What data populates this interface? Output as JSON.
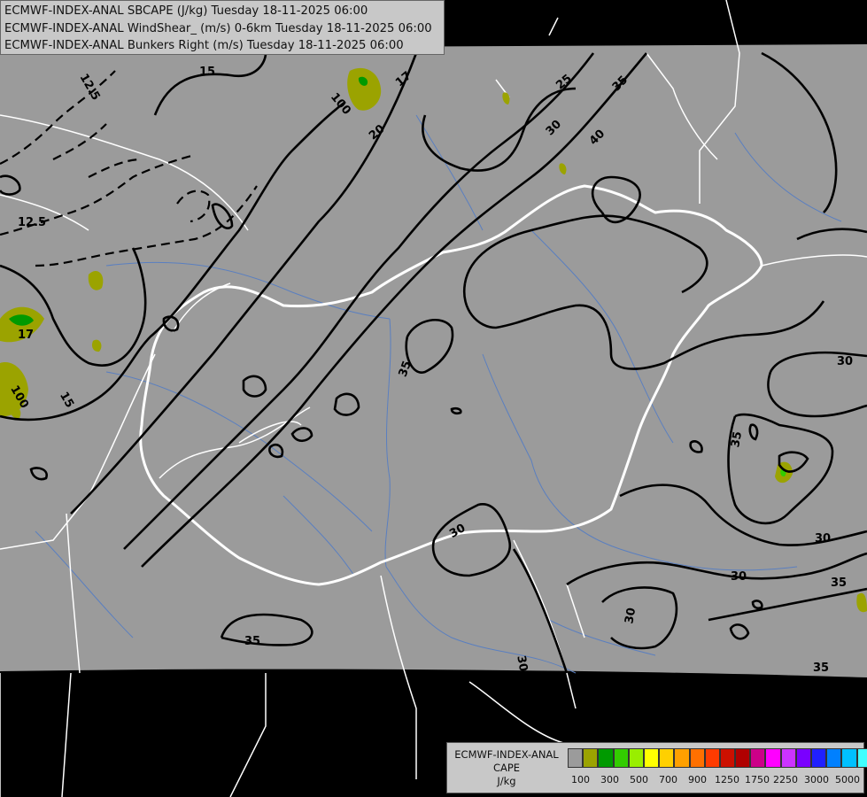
{
  "titles": [
    "ECMWF-INDEX-ANAL SBCAPE (J/kg) Tuesday 18-11-2025 06:00",
    "ECMWF-INDEX-ANAL WindShear_ (m/s) 0-6km Tuesday 18-11-2025 06:00",
    "ECMWF-INDEX-ANAL Bunkers Right (m/s) Tuesday 18-11-2025 06:00"
  ],
  "colors": {
    "map_fill": "#9b9b9b",
    "background": "#000000",
    "border": "#ffffff",
    "river": "#5a7fc0",
    "contour": "#000000"
  },
  "contour_labels": [
    "12.5",
    "12.5",
    "15",
    "15",
    "17",
    "17",
    "20",
    "25",
    "30",
    "30",
    "30",
    "30",
    "30",
    "30",
    "30",
    "35",
    "35",
    "35",
    "35",
    "35",
    "35",
    "35",
    "40",
    "100",
    "100"
  ],
  "legend": {
    "line1": "ECMWF-INDEX-ANAL",
    "line2": "CAPE",
    "line3": "J/kg",
    "colors": [
      "#9b9b9b",
      "#9ba300",
      "#009a00",
      "#33cc00",
      "#99ee00",
      "#ffff00",
      "#ffd000",
      "#ffa000",
      "#ff7000",
      "#ff3b00",
      "#cc1000",
      "#b00000",
      "#cc0088",
      "#ff00ff",
      "#cc33ff",
      "#7a00ff",
      "#2020ff",
      "#0080ff",
      "#00c0ff",
      "#40ffff",
      "#ffffff"
    ],
    "ticks": [
      "100",
      "300",
      "500",
      "700",
      "900",
      "1250",
      "1750",
      "2250",
      "3000",
      "5000"
    ]
  }
}
